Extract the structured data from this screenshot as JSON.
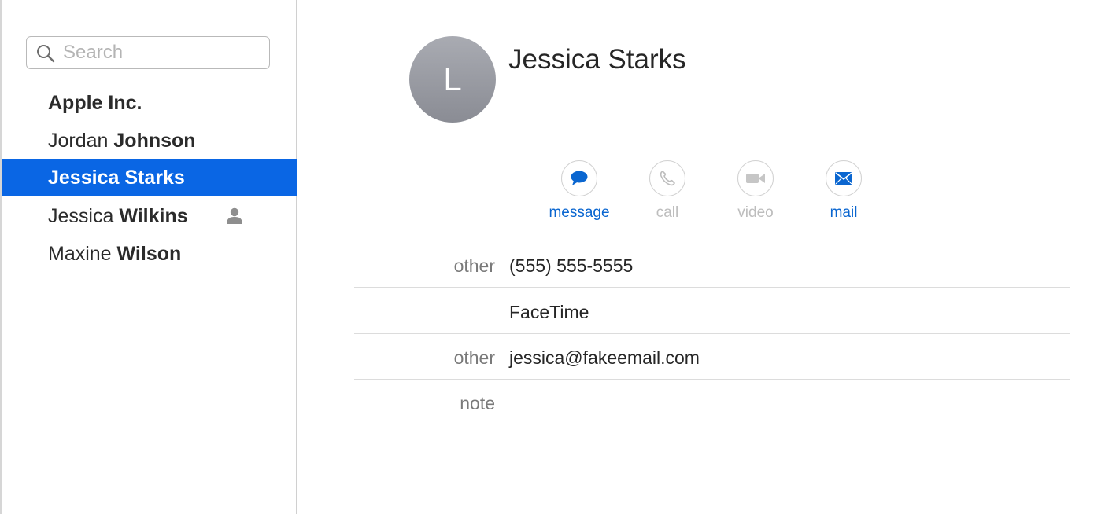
{
  "search": {
    "placeholder": "Search",
    "value": ""
  },
  "contacts": [
    {
      "first": "",
      "last": "Apple Inc.",
      "kind": "company"
    },
    {
      "first": "Jordan",
      "last": "Johnson"
    },
    {
      "first": "Jessica",
      "last": "Starks",
      "selected": true
    },
    {
      "first": "Jessica",
      "last": "Wilkins",
      "icon": "person-icon"
    },
    {
      "first": "Maxine",
      "last": "Wilson"
    }
  ],
  "detail": {
    "avatar_initial": "L",
    "name": "Jessica Starks",
    "actions": [
      {
        "label": "message",
        "icon": "message-bubble-icon",
        "enabled": true
      },
      {
        "label": "call",
        "icon": "phone-icon",
        "enabled": false
      },
      {
        "label": "video",
        "icon": "video-camera-icon",
        "enabled": false
      },
      {
        "label": "mail",
        "icon": "envelope-icon",
        "enabled": true
      }
    ],
    "fields": [
      {
        "key": "other",
        "value": "(555) 555-5555"
      },
      {
        "key": "",
        "value": "FaceTime"
      },
      {
        "key": "other",
        "value": "jessica@fakeemail.com"
      },
      {
        "key": "note",
        "value": ""
      }
    ]
  },
  "colors": {
    "accent": "#0a66e4",
    "link": "#0a66d0",
    "disabled": "#bdbdbd",
    "label": "#7a7a7a"
  }
}
